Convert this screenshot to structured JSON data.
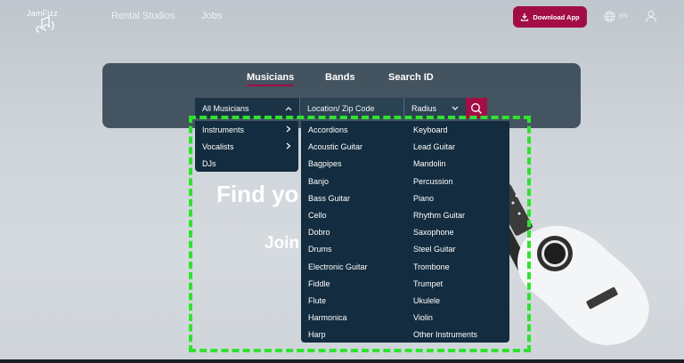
{
  "header": {
    "logo_text": "JamFizz",
    "nav": [
      "Rental Studios",
      "Jobs"
    ],
    "download_label": "Download App",
    "lang_label": "EN"
  },
  "search": {
    "tabs": [
      "Musicians",
      "Bands",
      "Search ID"
    ],
    "active_tab": "Musicians",
    "type_value": "All Musicians",
    "location_placeholder": "Location/ Zip Code",
    "radius_value": "Radius"
  },
  "hero": {
    "title_partial": "Find yo",
    "sub_partial": "Join"
  },
  "category_menu": [
    "Instruments",
    "Vocalists",
    "DJs"
  ],
  "instruments_left": [
    "Accordions",
    "Acoustic Guitar",
    "Bagpipes",
    "Banjo",
    "Bass Guitar",
    "Cello",
    "Dobro",
    "Drums",
    "Electronic Guitar",
    "Fiddle",
    "Flute",
    "Harmonica",
    "Harp"
  ],
  "instruments_right": [
    "Keyboard",
    "Lead Guitar",
    "Mandolin",
    "Percussion",
    "Piano",
    "Rhythm Guitar",
    "Saxophone",
    "Steel Guitar",
    "Trombone",
    "Trumpet",
    "Ukulele",
    "Violin",
    "Other Instruments"
  ],
  "colors": {
    "accent": "#a30d45",
    "panel": "#132c3f",
    "highlight": "#2ee32e"
  }
}
